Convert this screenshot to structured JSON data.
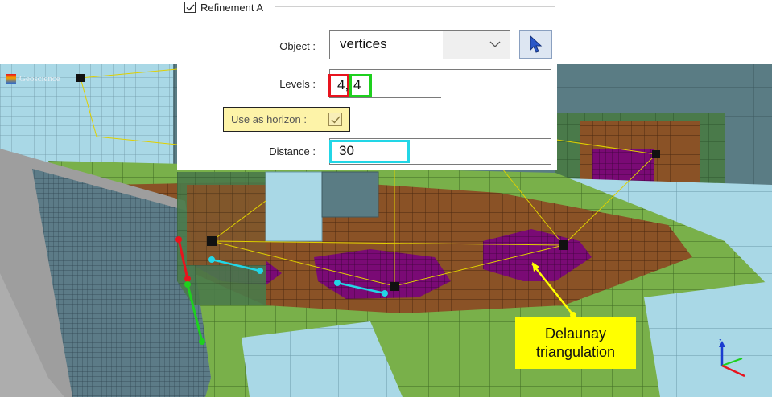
{
  "refinement": {
    "title": "Refinement A",
    "checked": true
  },
  "object": {
    "label": "Object :",
    "value": "vertices"
  },
  "levels": {
    "label": "Levels :",
    "value_1": "4,",
    "value_2": "4"
  },
  "horizon": {
    "label": "Use as horizon :",
    "checked": true
  },
  "distance": {
    "label": "Distance :",
    "value": "30"
  },
  "callout": {
    "line1": "Delaunay",
    "line2": "triangulation"
  },
  "logo": {
    "text": "Geoscience"
  },
  "colors": {
    "panel_bg": "#ffffff",
    "horizon_highlight": "#fdf3a8",
    "levels_first_box": "#e8141e",
    "levels_second_box": "#1ed01e",
    "distance_box": "#22d6e6",
    "mesh_green": "#79b04a",
    "mesh_brown": "#8a5226",
    "mesh_purple": "#7a0a75",
    "mesh_lightblue": "#a9d8e6",
    "callout_bg": "#ffff00"
  },
  "icons": [
    "checkmark-icon",
    "chevron-down-icon",
    "cursor-pointer-icon",
    "axis-triad-icon"
  ]
}
